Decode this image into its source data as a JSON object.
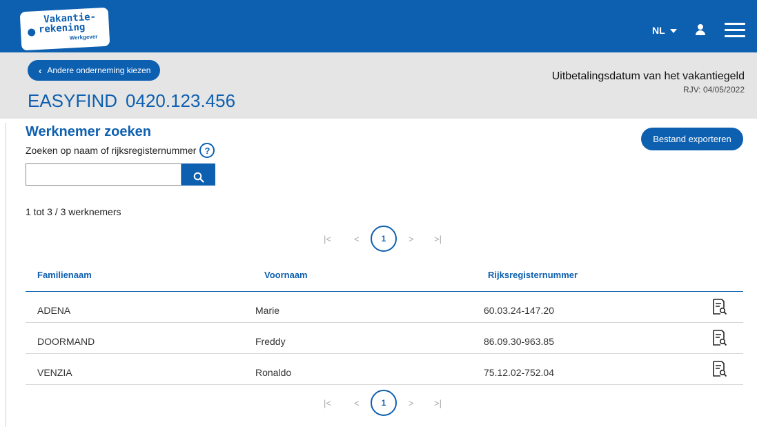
{
  "header": {
    "logo_line1": "Vakantie-",
    "logo_line2": "rekening",
    "logo_line3": "Werkgever",
    "language": "NL",
    "brand_color": "#0d5fb0"
  },
  "company_bar": {
    "back_label": "Andere onderneming kiezen",
    "company_name": "EASYFIND",
    "company_number": "0420.123.456",
    "payment_title": "Uitbetalingsdatum van het vakantiegeld",
    "payment_date": "RJV: 04/05/2022"
  },
  "search": {
    "title": "Werknemer zoeken",
    "hint": "Zoeken op naam of rijksregisternummer",
    "help_glyph": "?",
    "value": "",
    "export_label": "Bestand exporteren"
  },
  "results": {
    "count": "1 tot 3 / 3 werknemers",
    "current_page": "1",
    "columns": [
      "Familienaam",
      "Voornaam",
      "Rijksregisternummer"
    ],
    "rows": [
      {
        "lastname": "ADENA",
        "firstname": "Marie",
        "nr": "60.03.24-147.20"
      },
      {
        "lastname": "DOORMAND",
        "firstname": "Freddy",
        "nr": "86.09.30-963.85"
      },
      {
        "lastname": "VENZIA",
        "firstname": "Ronaldo",
        "nr": "75.12.02-752.04"
      }
    ]
  },
  "pager_glyphs": {
    "first": "|<",
    "prev": "<",
    "next": ">",
    "last": ">|"
  }
}
